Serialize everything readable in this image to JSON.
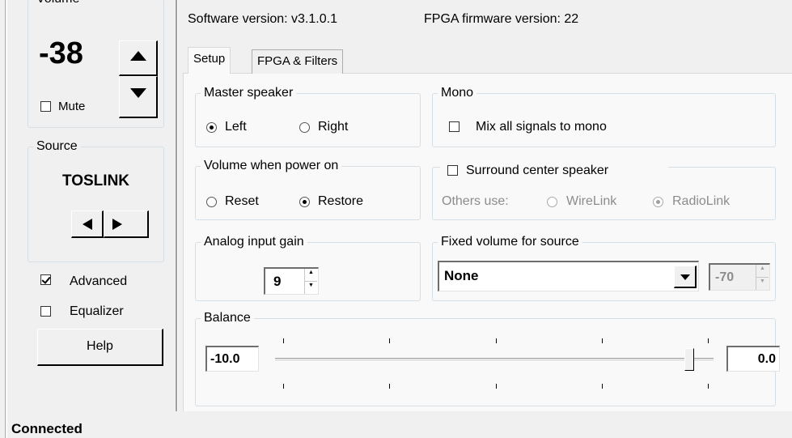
{
  "volume": {
    "group_label": "Volume",
    "value": "-38",
    "mute_label": "Mute",
    "up_icon": "triangle-up-icon",
    "down_icon": "triangle-down-icon"
  },
  "source": {
    "group_label": "Source",
    "value": "TOSLINK",
    "prev_icon": "triangle-left-icon",
    "next_icon": "triangle-right-icon"
  },
  "options": {
    "advanced_label": "Advanced",
    "equalizer_label": "Equalizer",
    "help_label": "Help"
  },
  "status": "Connected",
  "header": {
    "software_version": "Software version: v3.1.0.1",
    "fpga_version": "FPGA firmware version:  22"
  },
  "tabs": [
    {
      "label": "Setup"
    },
    {
      "label": "FPGA & Filters"
    }
  ],
  "master_speaker": {
    "group_label": "Master speaker",
    "left_label": "Left",
    "right_label": "Right"
  },
  "mono": {
    "group_label": "Mono",
    "mix_label": "Mix all signals to mono"
  },
  "volume_power_on": {
    "group_label": "Volume when power on",
    "reset_label": "Reset",
    "restore_label": "Restore"
  },
  "surround": {
    "checkbox_label": "Surround center speaker",
    "others_label": "Others use:",
    "wirelink_label": "WireLink",
    "radiolink_label": "RadioLink"
  },
  "analog_gain": {
    "group_label": "Analog input gain",
    "value": "9"
  },
  "fixed_volume": {
    "group_label": "Fixed volume for source",
    "selected": "None",
    "level": "-70"
  },
  "balance": {
    "group_label": "Balance",
    "left_value": "-10.0",
    "right_value": "0.0",
    "position": 0.945
  },
  "colors": {
    "window_bg": "#f0f0f0",
    "tab_panel_bg": "#f9f9f9",
    "groupbox_border": "#d5dfe5",
    "disabled_text": "#8c8c8c"
  }
}
